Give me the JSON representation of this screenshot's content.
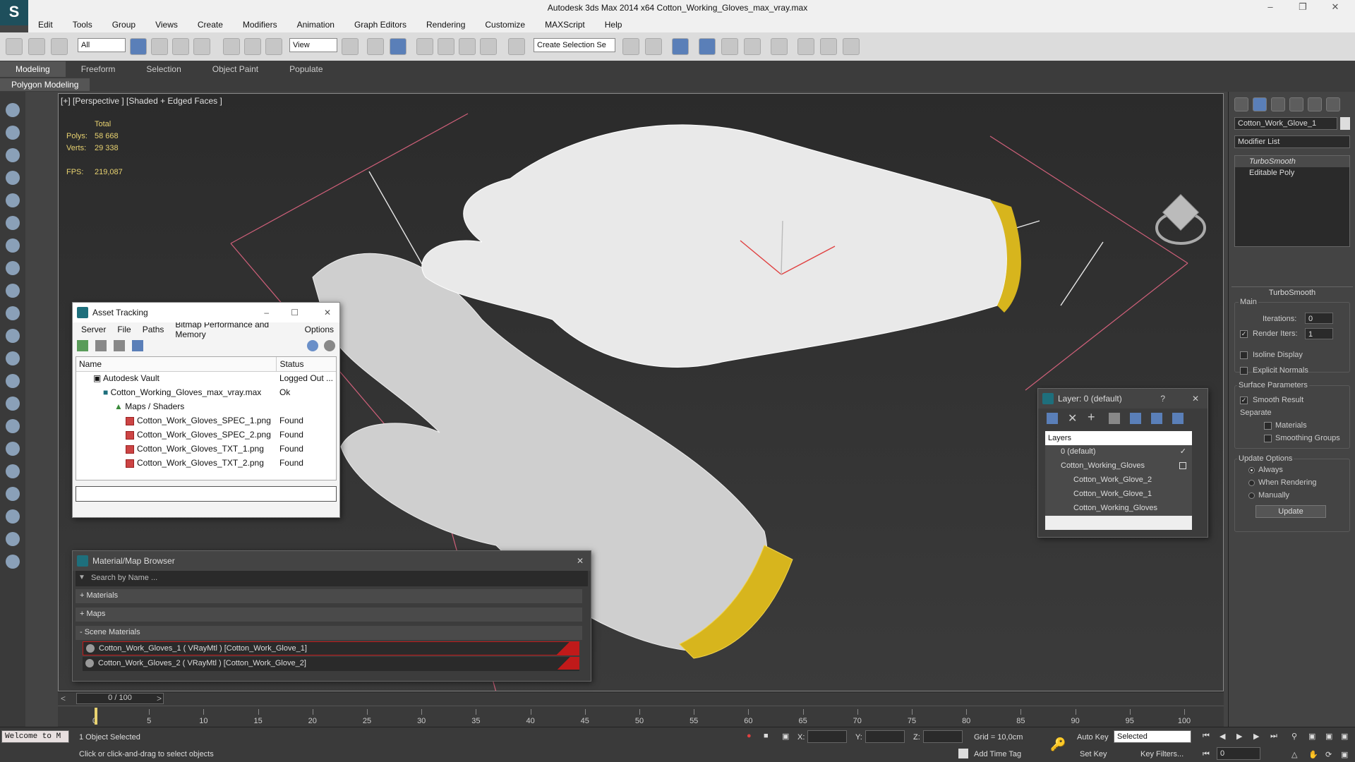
{
  "window": {
    "title": "Autodesk 3ds Max  2014 x64      Cotton_Working_Gloves_max_vray.max"
  },
  "menu": [
    "Edit",
    "Tools",
    "Group",
    "Views",
    "Create",
    "Modifiers",
    "Animation",
    "Graph Editors",
    "Rendering",
    "Customize",
    "MAXScript",
    "Help"
  ],
  "toolbar": {
    "filter_value": "All",
    "ref_coord_value": "View",
    "selection_set_placeholder": "Create Selection Se"
  },
  "ribbon": {
    "tabs": [
      "Modeling",
      "Freeform",
      "Selection",
      "Object Paint",
      "Populate"
    ],
    "sub_label": "Polygon Modeling"
  },
  "viewport": {
    "label": "[+] [Perspective ] [Shaded + Edged Faces ]",
    "stats": {
      "total_label": "Total",
      "polys_label": "Polys:",
      "polys_value": "58 668",
      "verts_label": "Verts:",
      "verts_value": "29 338",
      "fps_label": "FPS:",
      "fps_value": "219,087"
    }
  },
  "asset_tracking": {
    "title": "Asset Tracking",
    "menu": [
      "Server",
      "File",
      "Paths",
      "Bitmap Performance and Memory",
      "Options"
    ],
    "columns": [
      "Name",
      "Status"
    ],
    "rows": [
      {
        "name": "Autodesk Vault",
        "status": "Logged Out ..."
      },
      {
        "name": "Cotton_Working_Gloves_max_vray.max",
        "status": "Ok"
      },
      {
        "name": "Maps / Shaders",
        "status": ""
      },
      {
        "name": "Cotton_Work_Gloves_SPEC_1.png",
        "status": "Found"
      },
      {
        "name": "Cotton_Work_Gloves_SPEC_2.png",
        "status": "Found"
      },
      {
        "name": "Cotton_Work_Gloves_TXT_1.png",
        "status": "Found"
      },
      {
        "name": "Cotton_Work_Gloves_TXT_2.png",
        "status": "Found"
      }
    ]
  },
  "material_browser": {
    "title": "Material/Map Browser",
    "search_placeholder": "Search by Name ...",
    "sections": [
      "+ Materials",
      "+ Maps",
      "- Scene Materials"
    ],
    "materials": [
      "Cotton_Work_Gloves_1  ( VRayMtl ) [Cotton_Work_Glove_1]",
      "Cotton_Work_Gloves_2  ( VRayMtl ) [Cotton_Work_Glove_2]"
    ]
  },
  "layer_window": {
    "title": "Layer: 0 (default)",
    "help": "?",
    "header": "Layers",
    "items": [
      "0 (default)",
      "Cotton_Working_Gloves",
      "Cotton_Work_Glove_2",
      "Cotton_Work_Glove_1",
      "Cotton_Working_Gloves"
    ]
  },
  "command_panel": {
    "object_name": "Cotton_Work_Glove_1",
    "modifier_list": "Modifier List",
    "stack": [
      "TurboSmooth",
      "Editable Poly"
    ],
    "rollout_title": "TurboSmooth",
    "main_label": "Main",
    "iterations_label": "Iterations:",
    "iterations_value": "0",
    "render_iters_label": "Render Iters:",
    "render_iters_value": "1",
    "isoline_label": "Isoline Display",
    "explicit_normals_label": "Explicit Normals",
    "surface_params_label": "Surface Parameters",
    "smooth_result_label": "Smooth Result",
    "separate_label": "Separate",
    "materials_label": "Materials",
    "smoothing_groups_label": "Smoothing Groups",
    "update_options_label": "Update Options",
    "always_label": "Always",
    "when_rendering_label": "When Rendering",
    "manually_label": "Manually",
    "update_button": "Update"
  },
  "timeline": {
    "frame_label": "0 / 100",
    "ticks": [
      "0",
      "5",
      "10",
      "15",
      "20",
      "25",
      "30",
      "35",
      "40",
      "45",
      "50",
      "55",
      "60",
      "65",
      "70",
      "75",
      "80",
      "85",
      "90",
      "95",
      "100"
    ]
  },
  "status": {
    "welcome": "Welcome to M",
    "selected": "1 Object Selected",
    "prompt": "Click or click-and-drag to select objects",
    "x_label": "X:",
    "y_label": "Y:",
    "z_label": "Z:",
    "grid": "Grid = 10,0cm",
    "add_time_tag": "Add Time Tag",
    "auto_key": "Auto Key",
    "set_key": "Set Key",
    "selected_dropdown": "Selected",
    "key_filters": "Key Filters...",
    "frame_value": "0"
  },
  "colors": {
    "accent": "#1e4f5c",
    "selection_red": "#c01a1a",
    "stats_yellow": "#e8d270"
  }
}
